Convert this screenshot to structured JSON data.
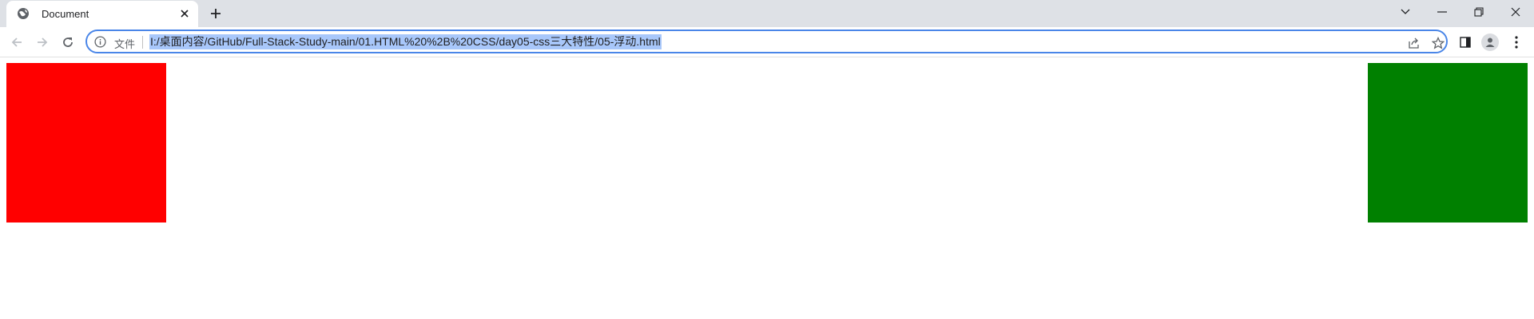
{
  "window": {
    "controls": [
      "tab-search",
      "minimize",
      "restore",
      "close"
    ]
  },
  "tab": {
    "title": "Document",
    "favicon": "globe-icon"
  },
  "toolbar": {
    "back_icon": "arrow-left-icon",
    "forward_icon": "arrow-right-icon",
    "reload_icon": "reload-icon"
  },
  "address_bar": {
    "scheme_label": "文件",
    "url": "I:/桌面内容/GitHub/Full-Stack-Study-main/01.HTML%20%2B%20CSS/day05-css三大特性/05-浮动.html",
    "selected": true,
    "selection_color": "#a8c7fa",
    "focus_color": "#4a86e8"
  },
  "page": {
    "boxes": [
      {
        "name": "left-float-box",
        "color": "#ff0000"
      },
      {
        "name": "right-float-box",
        "color": "#008000"
      }
    ]
  }
}
